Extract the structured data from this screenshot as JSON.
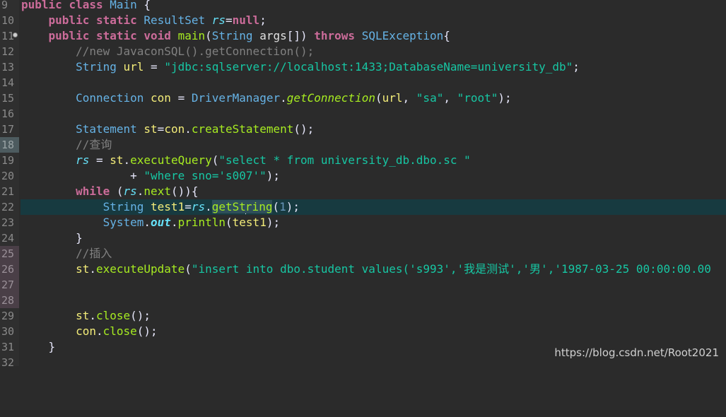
{
  "editor": {
    "lines": [
      {
        "num": "9",
        "text": "public class Main {"
      },
      {
        "num": "10",
        "text": "    public static ResultSet rs=null;"
      },
      {
        "num": "11",
        "text": "    public static void main(String args[]) throws SQLException{"
      },
      {
        "num": "12",
        "text": "        //new JavaconSQL().getConnection();"
      },
      {
        "num": "13",
        "text": "        String url = \"jdbc:sqlserver://localhost:1433;DatabaseName=university_db\";"
      },
      {
        "num": "14",
        "text": ""
      },
      {
        "num": "15",
        "text": "        Connection con = DriverManager.getConnection(url, \"sa\", \"root\");"
      },
      {
        "num": "16",
        "text": ""
      },
      {
        "num": "17",
        "text": "        Statement st=con.createStatement();"
      },
      {
        "num": "18",
        "text": "        //查询"
      },
      {
        "num": "19",
        "text": "        rs = st.executeQuery(\"select * from university_db.dbo.sc \""
      },
      {
        "num": "20",
        "text": "                + \"where sno='s007'\");"
      },
      {
        "num": "21",
        "text": "        while (rs.next()){"
      },
      {
        "num": "22",
        "text": "            String test1=rs.getString(1);"
      },
      {
        "num": "23",
        "text": "            System.out.println(test1);"
      },
      {
        "num": "24",
        "text": "        }"
      },
      {
        "num": "25",
        "text": "        //插入"
      },
      {
        "num": "26",
        "text": "        st.executeUpdate(\"insert into dbo.student values('s993','我是测试','男','1987-03-25 00:00:00.00"
      },
      {
        "num": "27",
        "text": ""
      },
      {
        "num": "28",
        "text": ""
      },
      {
        "num": "29",
        "text": "        st.close();"
      },
      {
        "num": "30",
        "text": "        con.close();"
      },
      {
        "num": "31",
        "text": "    }"
      },
      {
        "num": "32",
        "text": ""
      }
    ],
    "current_line": "22",
    "fold_marker_line": "11"
  },
  "watermark": "https://blog.csdn.net/Root2021",
  "colors": {
    "background": "#2b2b2b",
    "keyword": "#cc6c9a",
    "type": "#66b3e6",
    "method": "#a7ec21",
    "string": "#17c6a3",
    "comment": "#808080",
    "current_line_highlight": "#173a40"
  }
}
